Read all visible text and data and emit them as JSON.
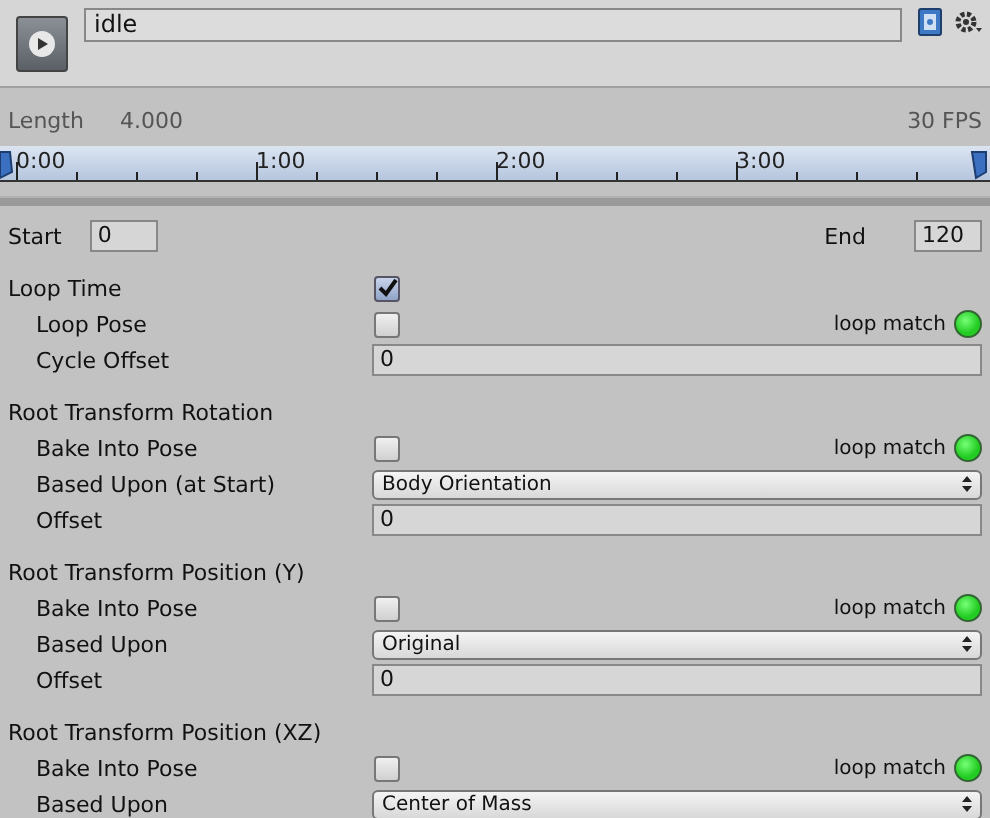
{
  "header": {
    "clip_name": "idle"
  },
  "timeline": {
    "length_label": "Length",
    "length": "4.000",
    "fps": "30 FPS",
    "ticks": [
      "0:00",
      "1:00",
      "2:00",
      "3:00"
    ]
  },
  "range": {
    "start_label": "Start",
    "start": "0",
    "end_label": "End",
    "end": "120"
  },
  "rows": [
    {
      "kind": "header-checkbox",
      "label": "Loop Time",
      "checked": true
    },
    {
      "kind": "checkbox",
      "label": "Loop Pose",
      "checked": false,
      "indicator": "loop match",
      "match": true
    },
    {
      "kind": "number",
      "label": "Cycle Offset",
      "value": "0"
    },
    {
      "kind": "header",
      "label": "Root Transform Rotation"
    },
    {
      "kind": "checkbox",
      "label": "Bake Into Pose",
      "checked": false,
      "indicator": "loop match",
      "match": true
    },
    {
      "kind": "dropdown",
      "label": "Based Upon (at Start)",
      "value": "Body Orientation"
    },
    {
      "kind": "number",
      "label": "Offset",
      "value": "0"
    },
    {
      "kind": "header",
      "label": "Root Transform Position (Y)"
    },
    {
      "kind": "checkbox",
      "label": "Bake Into Pose",
      "checked": false,
      "indicator": "loop match",
      "match": true
    },
    {
      "kind": "dropdown",
      "label": "Based Upon",
      "value": "Original"
    },
    {
      "kind": "number",
      "label": "Offset",
      "value": "0"
    },
    {
      "kind": "header",
      "label": "Root Transform Position (XZ)"
    },
    {
      "kind": "checkbox",
      "label": "Bake Into Pose",
      "checked": false,
      "indicator": "loop match",
      "match": true
    },
    {
      "kind": "dropdown",
      "label": "Based Upon",
      "value": "Center of Mass"
    }
  ]
}
